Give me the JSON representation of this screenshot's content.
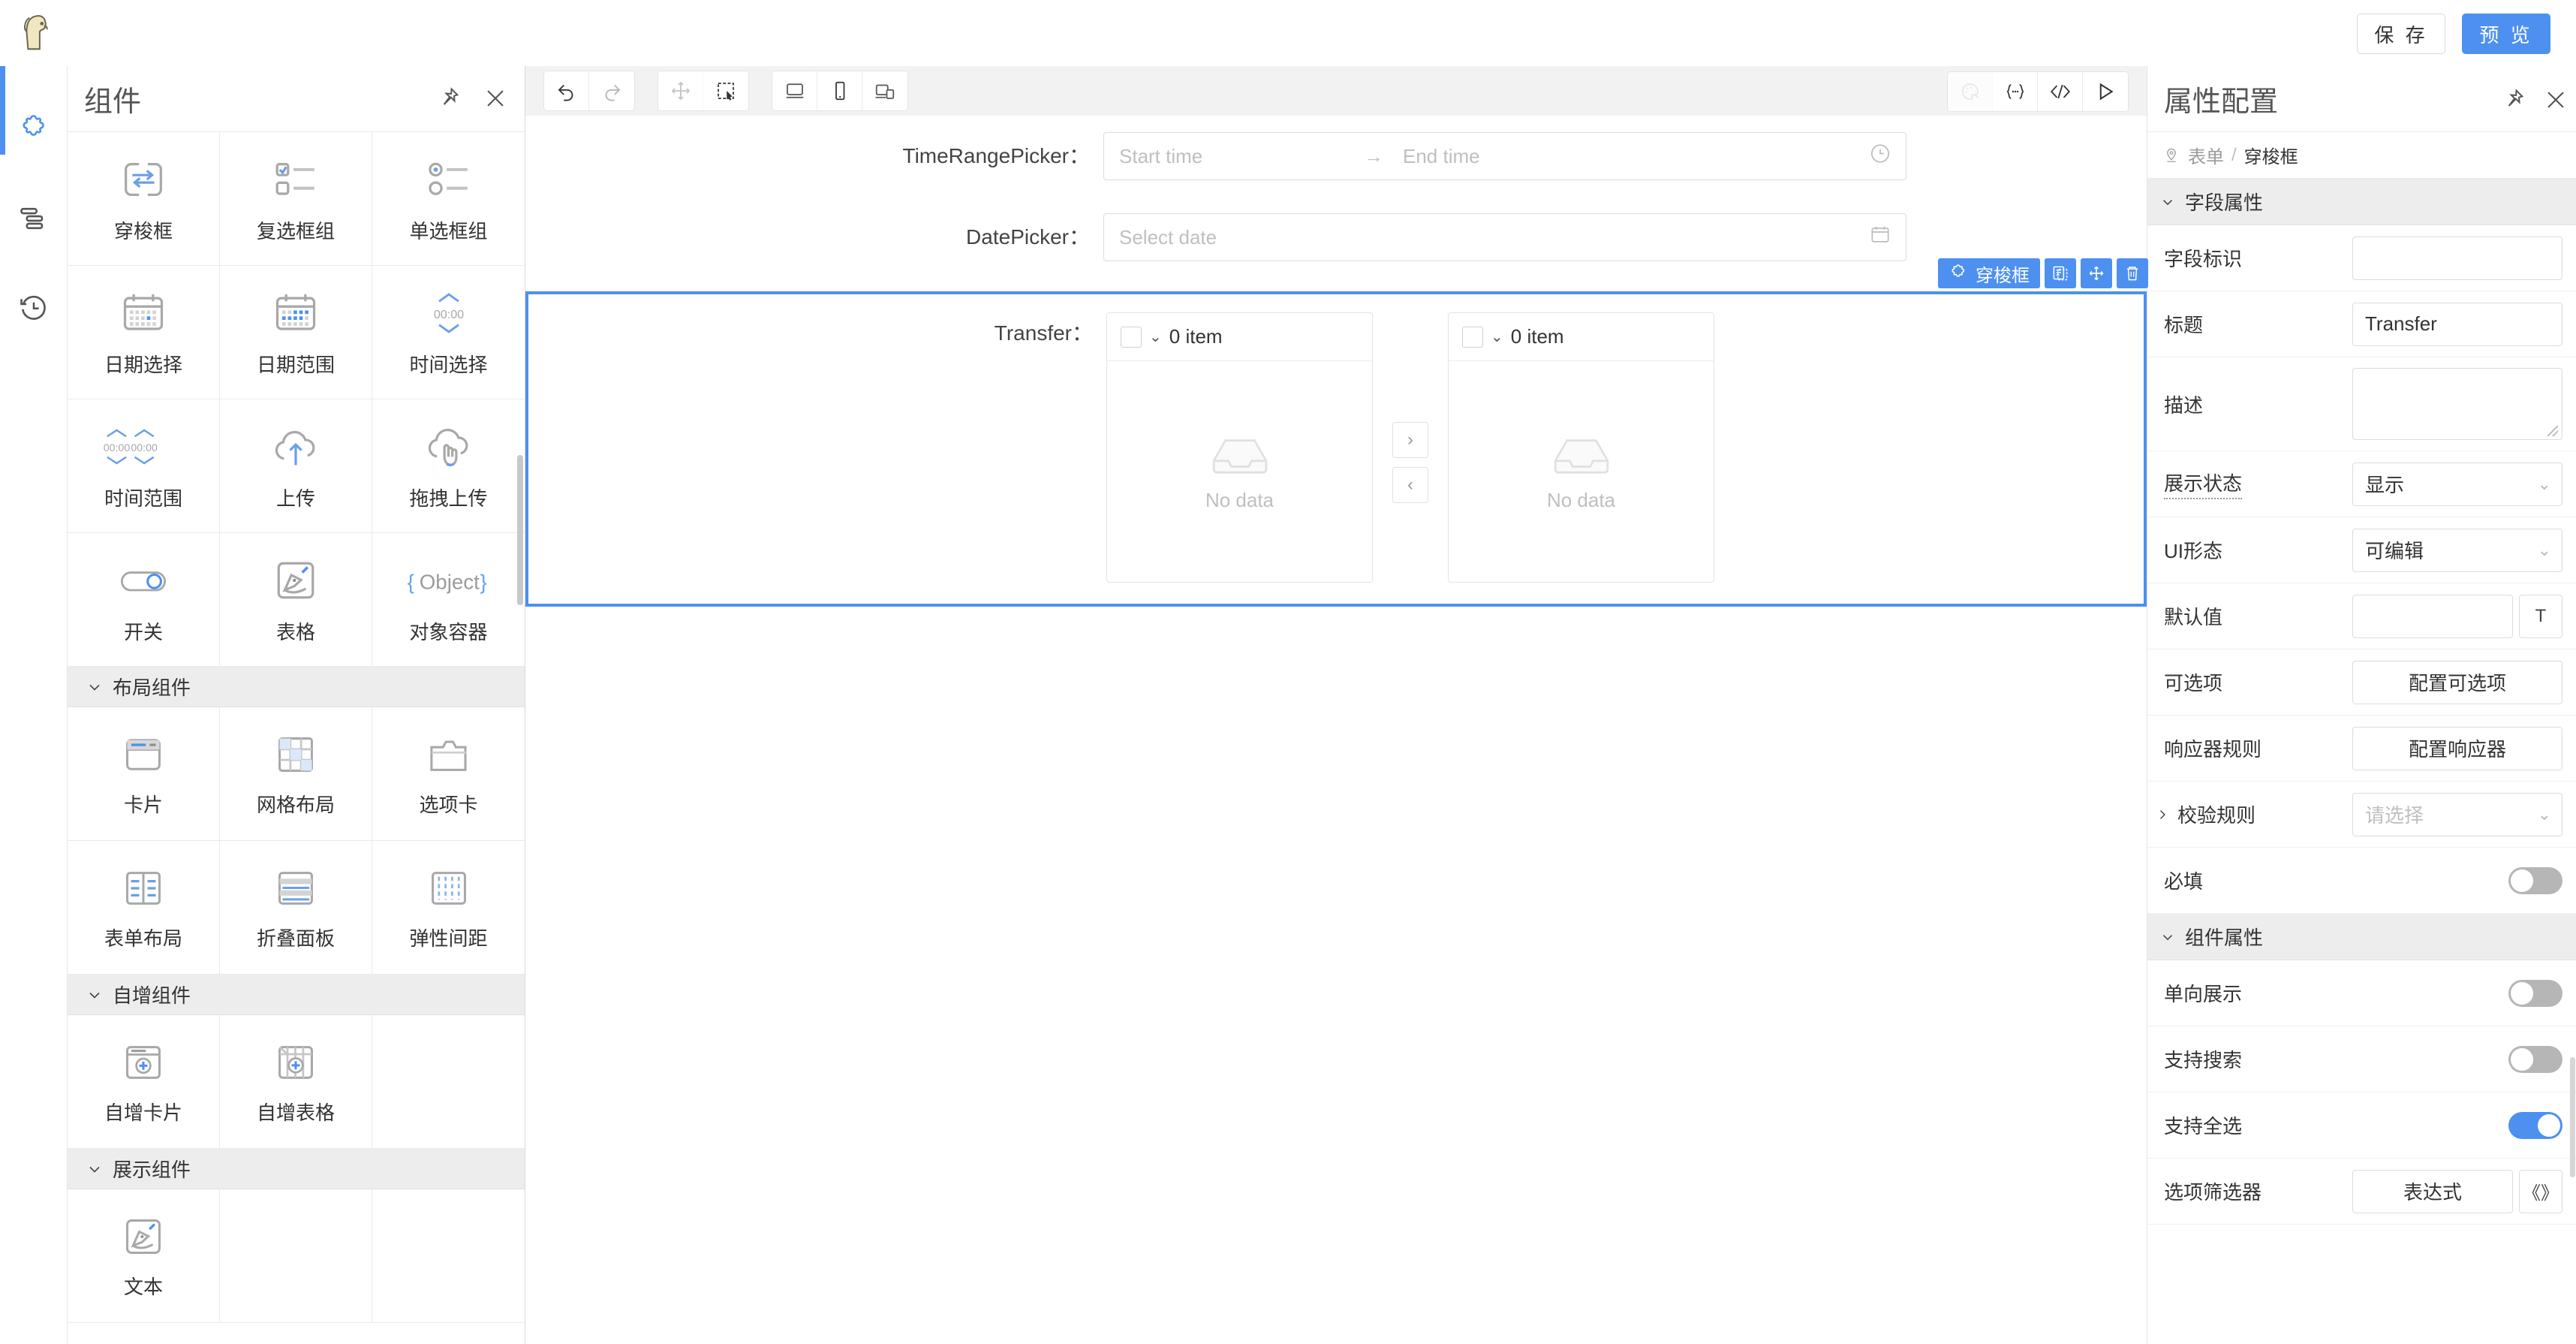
{
  "topbar": {
    "logo_icon": "app-logo-icon",
    "save_label": "保 存",
    "preview_label": "预 览"
  },
  "rail": {
    "items": [
      {
        "name": "components",
        "icon": "puzzle-icon",
        "active": true
      },
      {
        "name": "outline",
        "icon": "layers-outline-icon",
        "active": false
      },
      {
        "name": "history",
        "icon": "history-clock-icon",
        "active": false
      }
    ]
  },
  "component_panel": {
    "title": "组件",
    "pin_icon": "pin-icon",
    "close_icon": "close-icon",
    "groups": [
      {
        "label": "",
        "collapsed": false,
        "items": [
          {
            "label": "穿梭框",
            "icon": "transfer-icon"
          },
          {
            "label": "复选框组",
            "icon": "checkbox-group-icon"
          },
          {
            "label": "单选框组",
            "icon": "radio-group-icon"
          },
          {
            "label": "日期选择",
            "icon": "date-picker-icon"
          },
          {
            "label": "日期范围",
            "icon": "date-range-icon"
          },
          {
            "label": "时间选择",
            "icon": "time-picker-icon"
          },
          {
            "label": "时间范围",
            "icon": "time-range-icon"
          },
          {
            "label": "上传",
            "icon": "upload-cloud-icon"
          },
          {
            "label": "拖拽上传",
            "icon": "drag-upload-icon"
          },
          {
            "label": "开关",
            "icon": "switch-icon"
          },
          {
            "label": "表格",
            "icon": "signature-pen-icon"
          },
          {
            "label": "对象容器",
            "icon": "object-braces-icon"
          }
        ]
      },
      {
        "label": "布局组件",
        "collapsed": false,
        "items": [
          {
            "label": "卡片",
            "icon": "card-icon"
          },
          {
            "label": "网格布局",
            "icon": "grid-layout-icon"
          },
          {
            "label": "选项卡",
            "icon": "tabs-icon"
          },
          {
            "label": "表单布局",
            "icon": "form-layout-icon"
          },
          {
            "label": "折叠面板",
            "icon": "collapse-panel-icon"
          },
          {
            "label": "弹性间距",
            "icon": "flex-spacing-icon"
          }
        ]
      },
      {
        "label": "自增组件",
        "collapsed": false,
        "items": [
          {
            "label": "自增卡片",
            "icon": "add-card-icon"
          },
          {
            "label": "自增表格",
            "icon": "add-table-icon"
          }
        ]
      },
      {
        "label": "展示组件",
        "collapsed": false,
        "items": [
          {
            "label": "文本",
            "icon": "text-pen-icon"
          }
        ]
      }
    ]
  },
  "canvas": {
    "toolbar_left": [
      {
        "name": "undo",
        "icon": "undo-arrow-icon",
        "state": "enabled"
      },
      {
        "name": "redo",
        "icon": "redo-arrow-icon",
        "state": "disabled"
      }
    ],
    "toolbar_mode": [
      {
        "name": "move-mode",
        "icon": "move-arrows-icon",
        "state": "disabled"
      },
      {
        "name": "select-mode",
        "icon": "marquee-select-icon",
        "state": "selected"
      }
    ],
    "toolbar_device": [
      {
        "name": "desktop-preview",
        "icon": "desktop-icon",
        "state": "enabled"
      },
      {
        "name": "mobile-preview",
        "icon": "mobile-icon",
        "state": "enabled"
      },
      {
        "name": "responsive-preview",
        "icon": "responsive-icon",
        "state": "enabled"
      }
    ],
    "toolbar_right": [
      {
        "name": "theme",
        "icon": "palette-icon",
        "state": "disabled"
      },
      {
        "name": "schema",
        "icon": "braces-icon",
        "state": "enabled"
      },
      {
        "name": "code",
        "icon": "code-brackets-icon",
        "state": "enabled"
      },
      {
        "name": "run",
        "icon": "play-triangle-icon",
        "state": "enabled"
      }
    ],
    "fields": [
      {
        "type": "time-range-picker",
        "label": "TimeRangePicker：",
        "start_placeholder": "Start time",
        "separator": "→",
        "end_placeholder": "End time",
        "tail_icon": "clock-icon"
      },
      {
        "type": "date-picker",
        "label": "DatePicker：",
        "placeholder": "Select date",
        "tail_icon": "calendar-icon"
      }
    ],
    "selected_widget": {
      "label": "Transfer：",
      "badge": {
        "tag_icon": "puzzle-icon",
        "tag_label": "穿梭框",
        "actions": [
          {
            "name": "duplicate",
            "icon": "copy-icon"
          },
          {
            "name": "move",
            "icon": "move-arrows-icon"
          },
          {
            "name": "delete",
            "icon": "trash-icon"
          }
        ]
      },
      "panels": [
        {
          "side": "source",
          "checkbox_checked": false,
          "chevron": "⌄",
          "count_label": "0 item",
          "empty_icon": "inbox-icon",
          "empty_label": "No data"
        },
        {
          "side": "target",
          "checkbox_checked": false,
          "chevron": "⌄",
          "count_label": "0 item",
          "empty_icon": "inbox-icon",
          "empty_label": "No data"
        }
      ],
      "move_right_label": "›",
      "move_left_label": "‹"
    }
  },
  "properties": {
    "title": "属性配置",
    "pin_icon": "pin-icon",
    "close_icon": "close-icon",
    "breadcrumb": {
      "location_icon": "location-pin-icon",
      "parent": "表单",
      "separator": "/",
      "current": "穿梭框"
    },
    "sections": [
      {
        "label": "字段属性",
        "collapsed": false,
        "rows": [
          {
            "label": "字段标识",
            "control": "input",
            "value": "",
            "placeholder": ""
          },
          {
            "label": "标题",
            "control": "input",
            "value": "Transfer",
            "placeholder": ""
          },
          {
            "label": "描述",
            "control": "textarea",
            "value": "",
            "placeholder": ""
          },
          {
            "label": "展示状态",
            "control": "select",
            "value": "显示",
            "hint": true
          },
          {
            "label": "UI形态",
            "control": "select",
            "value": "可编辑"
          },
          {
            "label": "默认值",
            "control": "input-with-button",
            "value": "",
            "button_label": "T",
            "button_icon": "text-type-icon"
          },
          {
            "label": "可选项",
            "control": "button",
            "button_label": "配置可选项"
          },
          {
            "label": "响应器规则",
            "control": "button",
            "button_label": "配置响应器"
          },
          {
            "label": "校验规则",
            "control": "select",
            "value": "请选择",
            "placeholder_state": true,
            "collapsible": true,
            "collapsed": true
          },
          {
            "label": "必填",
            "control": "toggle",
            "value": false
          }
        ]
      },
      {
        "label": "组件属性",
        "collapsed": false,
        "rows": [
          {
            "label": "单向展示",
            "control": "toggle",
            "value": false
          },
          {
            "label": "支持搜索",
            "control": "toggle",
            "value": false
          },
          {
            "label": "支持全选",
            "control": "toggle",
            "value": true
          },
          {
            "label": "选项筛选器",
            "control": "button-with-button",
            "button_label": "表达式",
            "button2_label": "《》"
          }
        ]
      }
    ]
  },
  "colors": {
    "accent": "#4d90f0",
    "panel_header_bg": "#ededed",
    "canvas_bg": "#f2f2f2",
    "border": "#e4e4e4",
    "muted_text": "#bfbfbf"
  }
}
